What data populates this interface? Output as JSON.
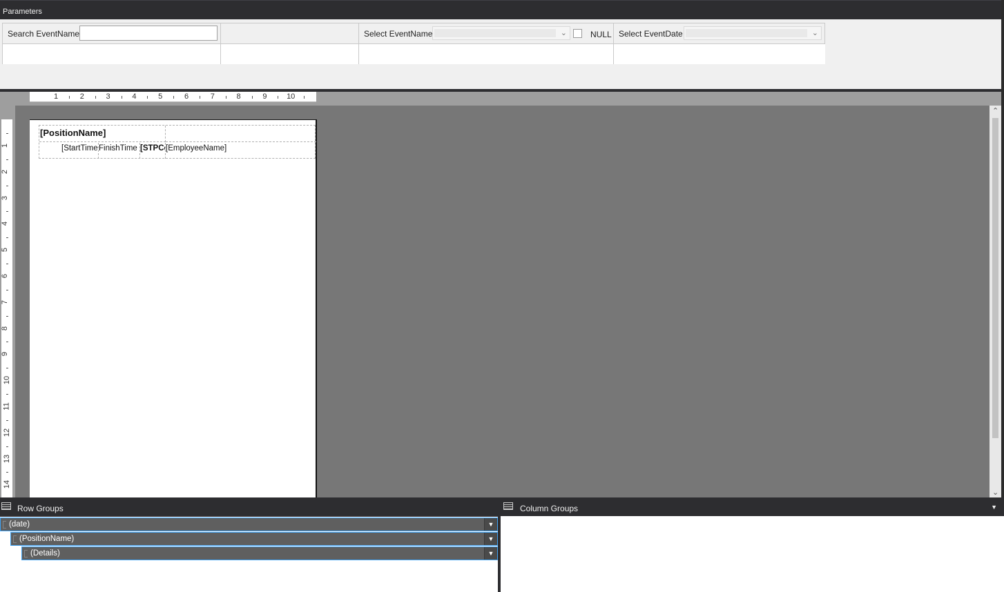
{
  "params": {
    "title": "Parameters",
    "search_label": "Search EventName",
    "search_value": "",
    "select_event_label": "Select EventName",
    "null_label": "NULL",
    "select_date_label": "Select EventDate"
  },
  "ruler": {
    "h_numbers": [
      "1",
      "2",
      "3",
      "4",
      "5",
      "6",
      "7",
      "8",
      "9",
      "10"
    ],
    "v_numbers": [
      "1",
      "2",
      "3",
      "4",
      "5",
      "6",
      "7",
      "8",
      "9",
      "10",
      "11",
      "12",
      "13",
      "14"
    ]
  },
  "report": {
    "header_field": "[PositionName]",
    "cells": [
      "[StartTime",
      "FinishTime",
      "[STPCo",
      "[EmployeeName]"
    ]
  },
  "groups": {
    "row_title": "Row Groups",
    "column_title": "Column Groups",
    "items": [
      "(date)",
      "(PositionName)",
      "(Details)"
    ],
    "dropdown_glyph": "▼"
  }
}
